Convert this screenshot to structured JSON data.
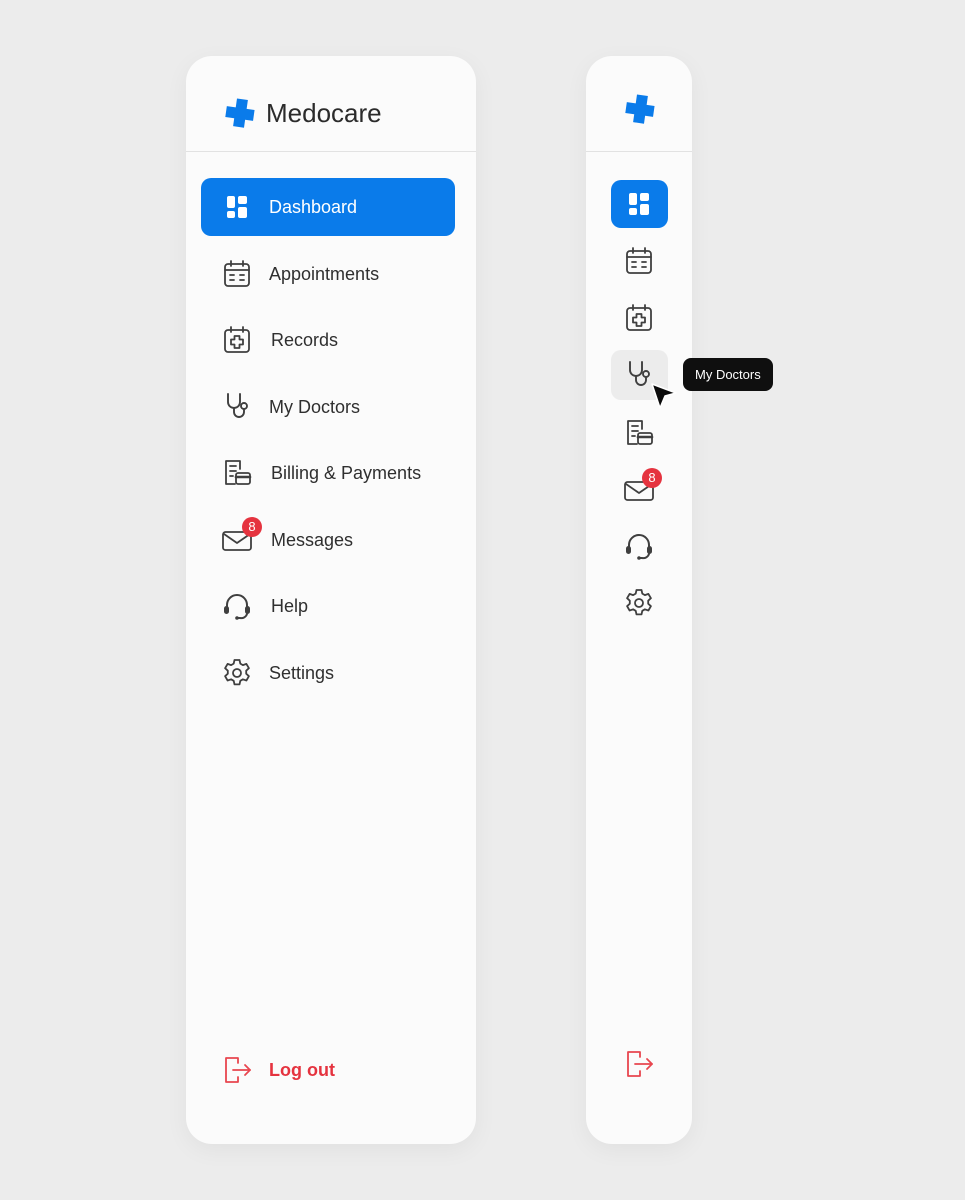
{
  "brand": {
    "name": "Medocare",
    "color": "#0a7bea"
  },
  "nav": {
    "items": [
      {
        "id": "dashboard",
        "label": "Dashboard",
        "icon": "dashboard-grid-icon",
        "active": true
      },
      {
        "id": "appointments",
        "label": "Appointments",
        "icon": "calendar-icon",
        "active": false
      },
      {
        "id": "records",
        "label": "Records",
        "icon": "medical-calendar-icon",
        "active": false
      },
      {
        "id": "my-doctors",
        "label": "My Doctors",
        "icon": "stethoscope-icon",
        "active": false
      },
      {
        "id": "billing",
        "label": "Billing & Payments",
        "icon": "billing-card-icon",
        "active": false
      },
      {
        "id": "messages",
        "label": "Messages",
        "icon": "envelope-icon",
        "active": false,
        "badge": "8"
      },
      {
        "id": "help",
        "label": "Help",
        "icon": "headset-icon",
        "active": false
      },
      {
        "id": "settings",
        "label": "Settings",
        "icon": "gear-icon",
        "active": false
      }
    ],
    "logout": {
      "label": "Log out",
      "icon": "logout-icon"
    }
  },
  "collapsed": {
    "hovered_item": "my-doctors",
    "tooltip": "My Doctors"
  },
  "colors": {
    "accent": "#0a7bea",
    "danger": "#e5333f",
    "badge": "#e5333f",
    "text": "#2f2f2f",
    "background": "#ececec",
    "panel": "#fbfbfb"
  }
}
